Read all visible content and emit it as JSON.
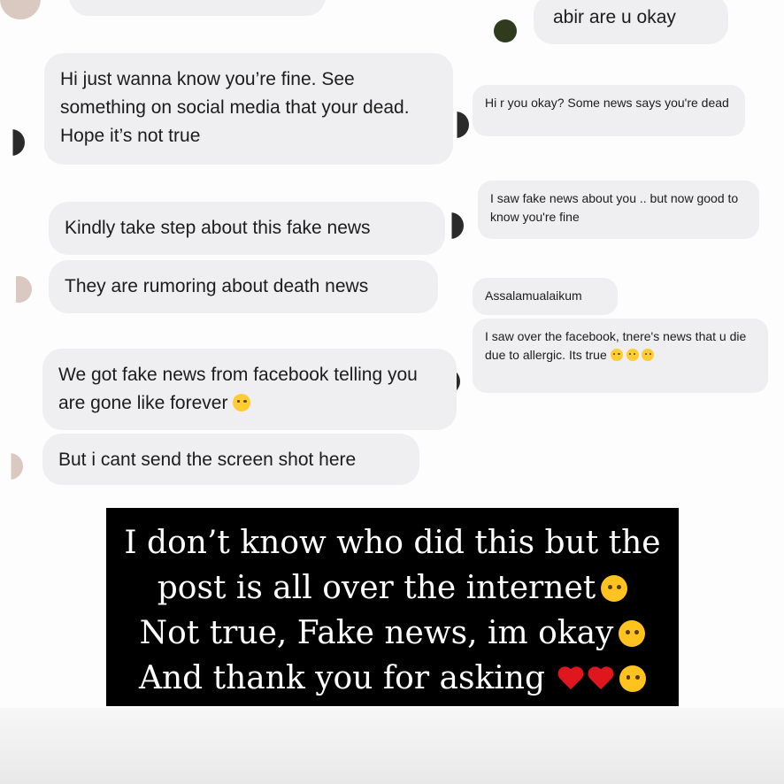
{
  "incoming_messages": [
    "Hi just wanna know you’re fine. See something on social media that your dead. Hope it’s not true",
    "Kindly take step about this fake news",
    "They are rumoring about death news",
    "We got fake news from facebook telling you are gone like forever",
    "But i cant send the screen shot here"
  ],
  "outgoing_messages": [
    "abir are u okay",
    "Hi r you okay? Some news says you're dead",
    "I saw fake news about you .. but now good to know you're fine",
    "Assalamualaikum",
    "I saw over the facebook, tnere's news that u die due to allergic. Its true"
  ],
  "caption_lines": [
    "I don’t know who did this but the",
    "post is all over the internet",
    "Not true, Fake news, im okay",
    "And thank you for asking"
  ],
  "icons": {
    "crying": "loudly-crying-face-icon",
    "upside_down": "upside-down-face-icon",
    "pleading": "pleading-face-icon",
    "heart": "red-heart-icon",
    "hearts_face": "smiling-face-with-hearts-icon"
  }
}
